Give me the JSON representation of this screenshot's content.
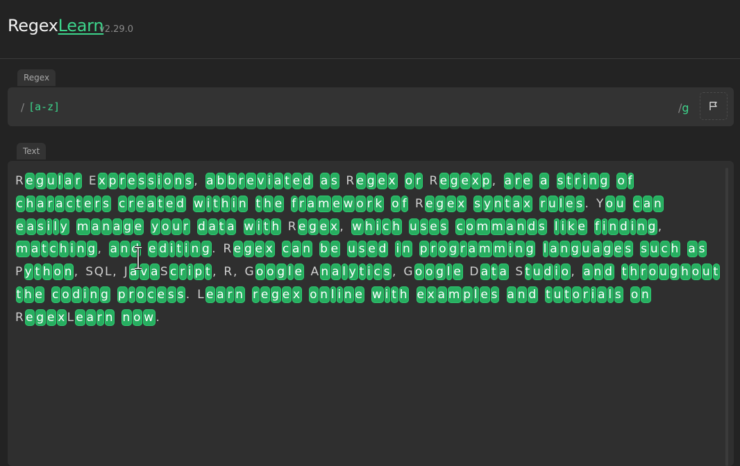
{
  "header": {
    "brand_regex": "Regex",
    "brand_learn": "Learn",
    "version": "v2.29.0"
  },
  "regex_panel": {
    "tab_label": "Regex",
    "slash_open": "/",
    "pattern": "[a-z]",
    "slash_close": "/",
    "flags": "g",
    "flag_button_icon": "flag-icon"
  },
  "text_panel": {
    "tab_label": "Text",
    "content": "Regular Expressions, abbreviated as Regex or Regexp, are a string of characters created within the framework of Regex syntax rules. You can easily manage your data with Regex, which uses commands like finding, matching, and editing. Regex can be used in programming languages such as Python, SQL, JavaScript, R, Google Analytics, Google Data Studio, and throughout the coding process. Learn regex online with examples and tutorials on RegexLearn now."
  },
  "colors": {
    "accent": "#3dd68c",
    "match_bg": "#27ae60",
    "background": "#232323",
    "panel": "#333333"
  }
}
